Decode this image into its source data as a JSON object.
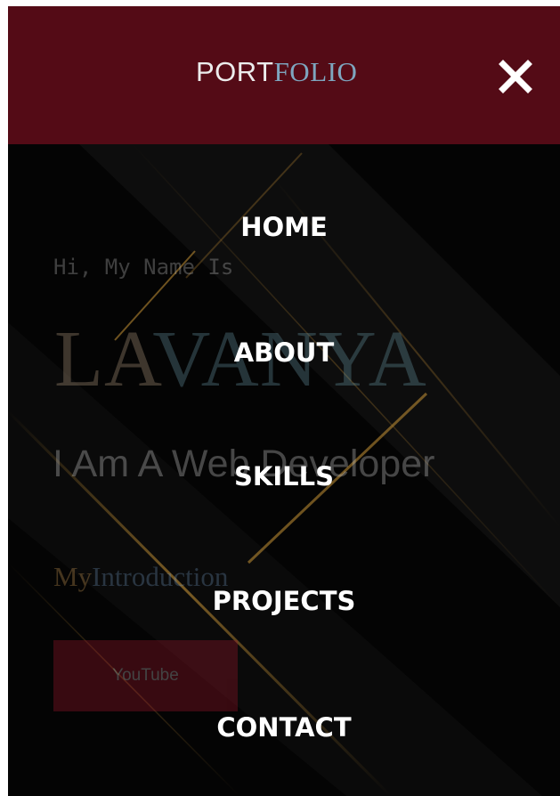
{
  "header": {
    "logo_part1": "PORT",
    "logo_part2": "FOLIO",
    "close_icon": "close-x-icon",
    "background_color": "#540b16"
  },
  "hero": {
    "greeting": "Hi, My Name Is",
    "name_part1": "LA",
    "name_part2": "VANYA",
    "role": "I Am A Web Developer",
    "intro_part1": "My",
    "intro_part2": "Introduction",
    "youtube_button": "YouTube"
  },
  "menu": {
    "items": [
      {
        "label": "HOME"
      },
      {
        "label": "ABOUT"
      },
      {
        "label": "SKILLS"
      },
      {
        "label": "PROJECTS"
      },
      {
        "label": "CONTACT"
      }
    ]
  },
  "colors": {
    "accent_gold": "#d9a13a",
    "accent_blue": "#7ea6bf",
    "button_red": "#a5172d"
  }
}
